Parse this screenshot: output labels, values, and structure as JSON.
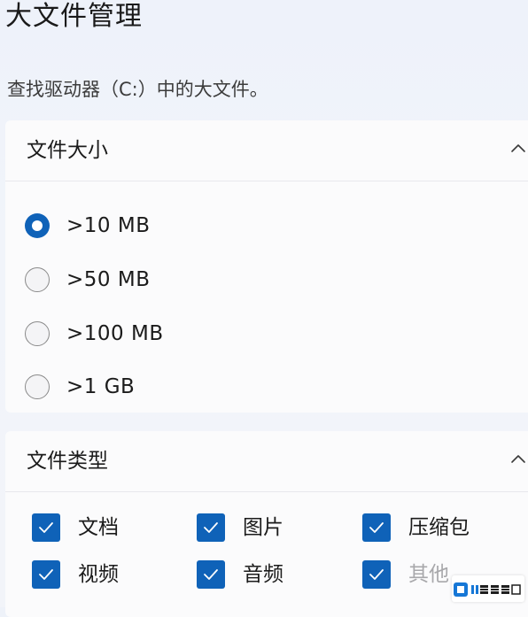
{
  "page": {
    "title": "大文件管理",
    "subtitle": "查找驱动器（C:）中的大文件。"
  },
  "size_section": {
    "header": "文件大小",
    "options": [
      {
        "label": ">10 MB",
        "selected": true
      },
      {
        "label": ">50 MB",
        "selected": false
      },
      {
        "label": ">100 MB",
        "selected": false
      },
      {
        "label": ">1 GB",
        "selected": false
      }
    ]
  },
  "type_section": {
    "header": "文件类型",
    "items": [
      {
        "label": "文档",
        "checked": true
      },
      {
        "label": "图片",
        "checked": true
      },
      {
        "label": "压缩包",
        "checked": true
      },
      {
        "label": "视频",
        "checked": true
      },
      {
        "label": "音频",
        "checked": true
      },
      {
        "label": "其他",
        "checked": true
      }
    ]
  },
  "colors": {
    "accent": "#0f62b8",
    "card_bg": "#fbfbfc",
    "page_bg": "#eef2f9"
  },
  "icons": {
    "collapse": "chevron-up-icon",
    "check": "checkmark-icon"
  },
  "watermark": {
    "logo_text": "53软件园"
  }
}
